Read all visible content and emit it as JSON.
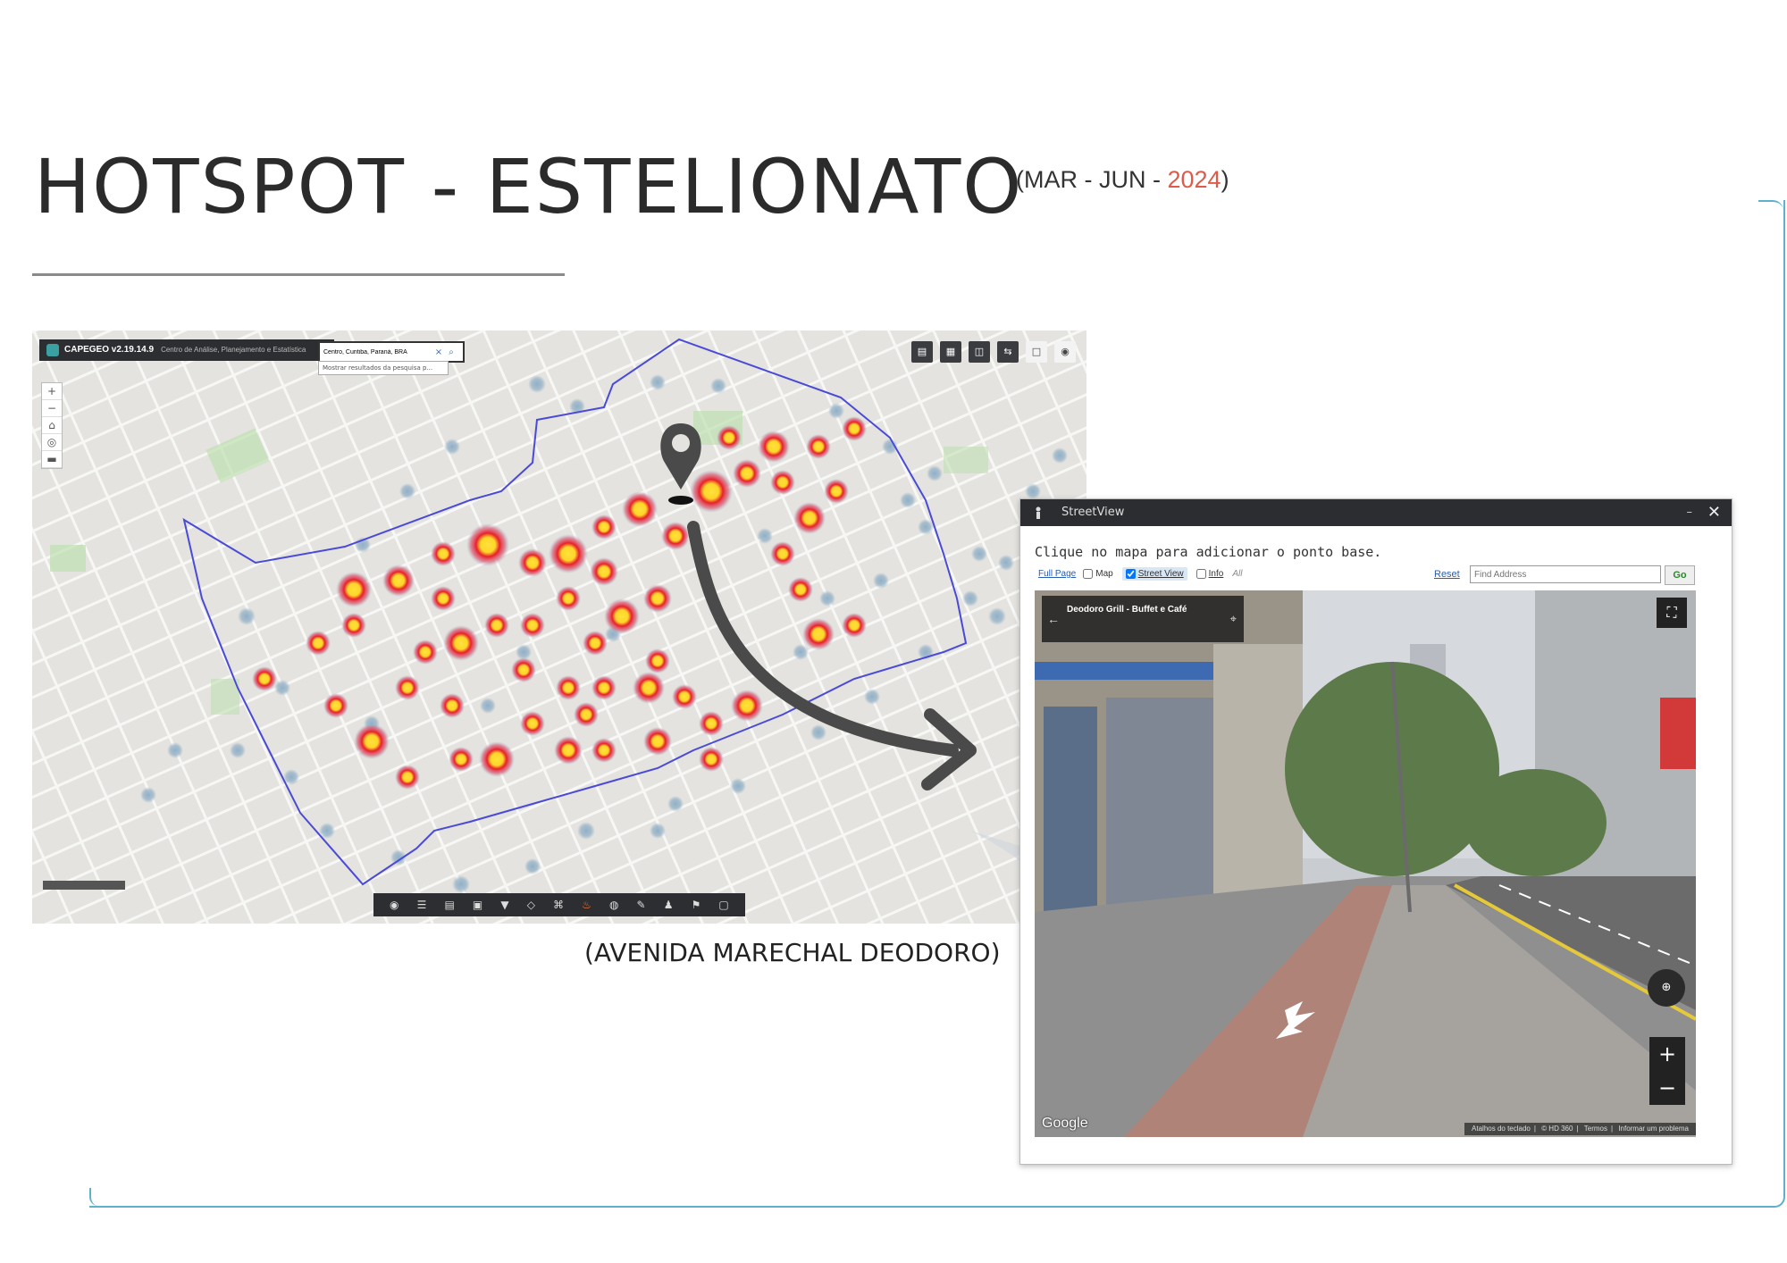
{
  "slide": {
    "title": "HOTSPOT - ESTELIONATO",
    "period_open": "(MAR -  JUN - ",
    "period_year": "2024",
    "period_close": ")",
    "caption": "(AVENIDA MARECHAL DEODORO)",
    "accent_color": "#e05a4a",
    "frame_color": "#5fb0c9"
  },
  "map": {
    "app_name": "CAPEGEO v2.19.14.9",
    "app_subtitle": "Centro de Análise, Planejamento e Estatística",
    "search_value": "Centro, Curitiba, Paraná, BRA",
    "search_suggestion": "Mostrar resultados da pesquisa p...",
    "zoom_in": "+",
    "zoom_out": "−",
    "hotspot_marker_icon": "map-pin-icon",
    "polygon_color": "#4a4ad8",
    "heat_colors": [
      "#9ab4c8",
      "#e05a6a",
      "#e8202a",
      "#ffe23a"
    ]
  },
  "streetview": {
    "window_title": "StreetView",
    "minimize": "–",
    "close": "✕",
    "instruction": "Clique no mapa para adicionar o ponto base.",
    "full_page": "Full Page",
    "opt_map": "Map",
    "opt_street": "Street View",
    "opt_info": "Info",
    "opt_all": "All",
    "reset": "Reset",
    "find_placeholder": "Find Address",
    "go": "Go",
    "place_name": "Deodoro Grill - Buffet e Café",
    "google": "Google",
    "footer": [
      "Atalhos do teclado",
      "© HD 360",
      "Termos",
      "Informar um problema"
    ]
  }
}
